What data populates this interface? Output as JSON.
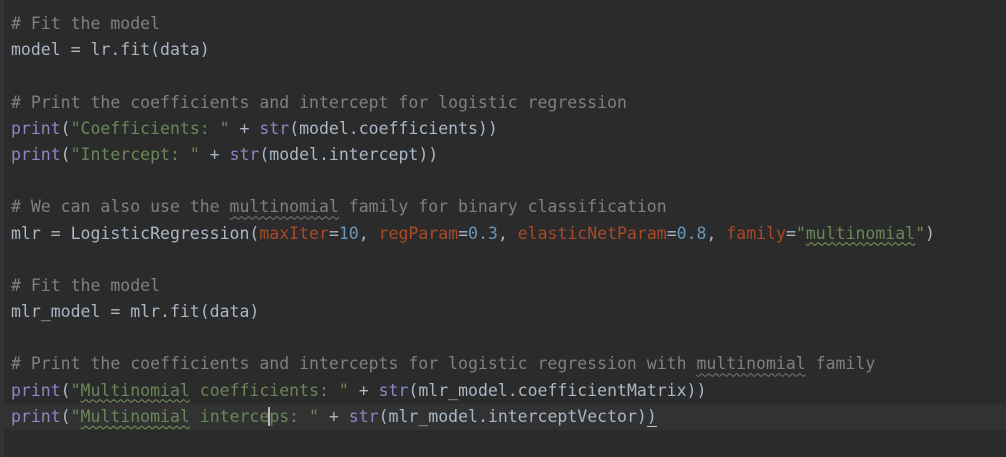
{
  "editor": {
    "lines": {
      "l1": {
        "comment": "# Fit the model"
      },
      "l2": {
        "text": "model = lr.fit(data)"
      },
      "l4": {
        "comment": "# Print the coefficients and intercept for logistic regression"
      },
      "l5": {
        "fn": "print",
        "p1": "(",
        "s": "\"Coefficients: \"",
        "plus": " + ",
        "fn2": "str",
        "rest": "(model.coefficients))"
      },
      "l6": {
        "fn": "print",
        "p1": "(",
        "s": "\"Intercept: \"",
        "plus": " + ",
        "fn2": "str",
        "rest": "(model.intercept))"
      },
      "l8": {
        "c1": "# We can also use the ",
        "c_typo": "multinomial",
        "c2": " family for binary classification"
      },
      "l9": {
        "a": "mlr = LogisticRegression(",
        "k1": "maxIter",
        "e1": "=",
        "n1": "10",
        "sep1": ", ",
        "k2": "regParam",
        "e2": "=",
        "n2": "0.3",
        "sep2": ", ",
        "k3": "elasticNetParam",
        "e3": "=",
        "n3": "0.8",
        "sep3": ", ",
        "k4": "family",
        "e4": "=",
        "s_open": "\"",
        "s_typo": "multinomial",
        "s_close": "\"",
        "end": ")"
      },
      "l11": {
        "comment": "# Fit the model"
      },
      "l12": {
        "text": "mlr_model = mlr.fit(data)"
      },
      "l14": {
        "c1": "# Print the coefficients and intercepts for logistic regression with ",
        "c_typo": "multinomial",
        "c2": " family"
      },
      "l15": {
        "fn": "print",
        "p1": "(",
        "s_open": "\"",
        "s_typo": "Multinomial",
        "s_rest": " coefficients: \"",
        "plus": " + ",
        "fn2": "str",
        "rest": "(mlr_model.coefficientMatrix))"
      },
      "l16": {
        "fn": "print",
        "p1": "(",
        "s_open": "\"",
        "s_typo": "Multinomial",
        "s_mid1": " interce",
        "s_mid2": "ps: \"",
        "plus": " + ",
        "fn2": "str",
        "rest": "(mlr_model.interceptVector)",
        "last": ")"
      }
    },
    "colors": {
      "background": "#2b2b2b",
      "text": "#a9b7c6",
      "comment": "#808080",
      "builtin": "#8888c6",
      "string": "#6a8759",
      "number": "#6897bb",
      "keyword_arg": "#aa4926",
      "current_line": "#323232"
    }
  }
}
